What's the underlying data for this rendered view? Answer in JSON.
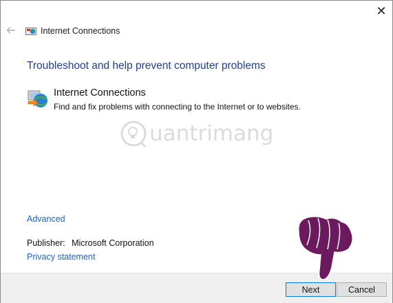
{
  "window": {
    "title": "Internet Connections",
    "close_glyph": "✕"
  },
  "main": {
    "heading": "Troubleshoot and help prevent computer problems",
    "item": {
      "title": "Internet Connections",
      "description": "Find and fix problems with connecting to the Internet or to websites.",
      "icon": "globe-network-icon"
    },
    "advanced_link": "Advanced",
    "publisher_label": "Publisher:",
    "publisher_value": "Microsoft Corporation",
    "privacy_link": "Privacy statement"
  },
  "watermark": {
    "text": "uantrimang"
  },
  "footer": {
    "next_label": "Next",
    "cancel_label": "Cancel"
  },
  "colors": {
    "heading": "#1e3f8a",
    "link": "#1f62c0",
    "footer_bg": "#f0f0f0",
    "pointer_fill": "#6b1a5e"
  }
}
